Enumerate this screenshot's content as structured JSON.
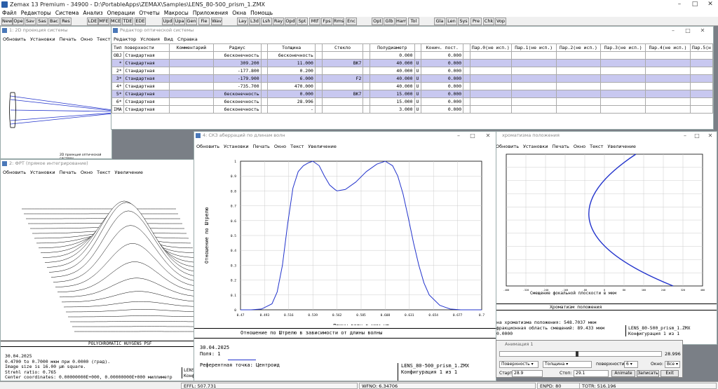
{
  "app": {
    "title": "Zemax 13 Premium - 34900 - D:\\PortableApps\\ZEMAX\\Samples\\LENS_80-500_prism_1.ZMX"
  },
  "menu": [
    "Файл",
    "Редакторы",
    "Система",
    "Анализ",
    "Операции",
    "Отчеты",
    "Макросы",
    "Приложения",
    "Окна",
    "Помощь"
  ],
  "toolbar": [
    "New",
    "Ope",
    "Sav",
    "Sas",
    "Bac",
    "Res",
    "LDE",
    "MFE",
    "MCE",
    "TDE",
    "EDE",
    "Upd",
    "Upa",
    "Gen",
    "Fie",
    "Wav",
    "Lay",
    "L3d",
    "Lsh",
    "Ray",
    "Opd",
    "Spt",
    "Mtf",
    "Fps",
    "Rms",
    "Enc",
    "Opt",
    "Glb",
    "Ham",
    "Tol",
    "Gla",
    "Len",
    "Sys",
    "Pre",
    "Chk",
    "Vop"
  ],
  "win_layout": {
    "title": "1: 2D проекция системы",
    "menu": [
      "Обновить",
      "Установки",
      "Печать",
      "Окно",
      "Текст",
      "Ув"
    ],
    "caption": "2D проекция оптической системы"
  },
  "win_editor": {
    "title": "Редактор оптической системы",
    "menu": [
      "Редактор",
      "Условия",
      "Вид",
      "Справка"
    ],
    "headers": [
      "Тип поверхности",
      "Комментарий",
      "Радиус",
      "",
      "Толщина",
      "",
      "Стекло",
      "",
      "Полудиаметр",
      "",
      "Конич. пост.",
      "",
      "Пар.0(не исп.)",
      "Пар.1(не исп.)",
      "Пар.2(не исп.)",
      "Пар.3(не исп.)",
      "Пар.4(не исп.)",
      "Пар.5(н"
    ],
    "rows": [
      {
        "n": "OBJ",
        "type": "Стандартная",
        "rad": "бесконечность",
        "th": "бесконечность",
        "glass": "",
        "sd": "0.000",
        "sdf": "",
        "con": "0.000",
        "hl": false
      },
      {
        "n": "*",
        "type": "Стандартная",
        "rad": "309.200",
        "th": "11.000",
        "glass": "BK7",
        "sd": "40.000",
        "sdf": "U",
        "con": "0.000",
        "hl": true
      },
      {
        "n": "2*",
        "type": "Стандартная",
        "rad": "-177.800",
        "th": "0.200",
        "glass": "",
        "sd": "40.000",
        "sdf": "U",
        "con": "0.000",
        "hl": false
      },
      {
        "n": "3*",
        "type": "Стандартная",
        "rad": "-179.900",
        "th": "6.000",
        "glass": "F2",
        "sd": "40.000",
        "sdf": "U",
        "con": "0.000",
        "hl": true
      },
      {
        "n": "4*",
        "type": "Стандартная",
        "rad": "-735.700",
        "th": "470.000",
        "glass": "",
        "sd": "40.000",
        "sdf": "U",
        "con": "0.000",
        "hl": false
      },
      {
        "n": "5*",
        "type": "Стандартная",
        "rad": "бесконечность",
        "th": "0.000",
        "glass": "BK7",
        "sd": "15.000",
        "sdf": "U",
        "con": "0.000",
        "hl": true
      },
      {
        "n": "6*",
        "type": "Стандартная",
        "rad": "бесконечность",
        "th": "28.996",
        "glass": "",
        "sd": "15.000",
        "sdf": "U",
        "con": "0.000",
        "hl": false
      },
      {
        "n": "IMA",
        "type": "Стандартная",
        "rad": "бесконечность",
        "th": "-",
        "glass": "",
        "sd": "3.000",
        "sdf": "U",
        "con": "0.000",
        "hl": false
      }
    ]
  },
  "win_psf": {
    "title": "2: ФРТ (прямое интегрирование)",
    "menu": [
      "Обновить",
      "Установки",
      "Печать",
      "Окно",
      "Текст",
      "Увеличение"
    ],
    "heading": "POLYCHROMATIC HUYGENS PSF",
    "date": "30.04.2025",
    "lines": [
      "0.4700 to 0.7000 мкм при 0.0000 (град).",
      "Image size is 16.00 µm square.",
      "Strehl ratio: 0.765",
      "Center coordinates: 0.00000000E+000, 0.00000000E+000 миллиметр"
    ],
    "corner": [
      "LENS",
      "Конфигурация 1 из 1"
    ]
  },
  "win_strehl": {
    "title": "4: СКЗ аберраций по длинам волн",
    "menu": [
      "Обновить",
      "Установки",
      "Печать",
      "Окно",
      "Текст",
      "Увеличение"
    ],
    "caption": "Отношение по Штрелю в зависимости от длины волны",
    "date": "30.04.2025",
    "field_label": "Поля:",
    "field_value": "1",
    "ref": "Референтная точка: Центроид",
    "lens": "LENS_80-500_prism_1.ZMX",
    "config": "Конфигурация 1 из 1"
  },
  "win_chrom": {
    "title": "хроматизма положения",
    "menu": [
      "Обновить",
      "Установки",
      "Печать",
      "Окно",
      "Текст",
      "Увеличение"
    ],
    "xlabel": "Смещение фокальной плоскости в мкм",
    "caption": "Хроматизм положения",
    "lines": [
      "на хроматизма положения: 548.7037 мкм",
      "фракционная область смещений: 89.433 мкм",
      "0.0000"
    ],
    "lens": "LENS_80-500_prism_1.ZMX",
    "config": "Конфигурация 1 из 1",
    "ticks": [
      "-400",
      "-320",
      "-240",
      "-160",
      "-80",
      "0",
      "80",
      "160",
      "240",
      "320",
      "400"
    ]
  },
  "anim": {
    "title": "Анимация 1",
    "value": "28.996",
    "type_sel": "Поверхность",
    "param_sel": "Толщина",
    "surf_label": "поверхности:",
    "surf_val": "6",
    "win_label": "Окно:",
    "win_val": "Все",
    "start_label": "Старт:",
    "start_val": "28.9",
    "stop_label": "Стоп:",
    "stop_val": "29.1",
    "b_animate": "Animate",
    "b_record": "Записать",
    "b_exit": "Exit"
  },
  "status": {
    "effl": "EFFL: 507.731",
    "wfno": "WFNO: 6.34706",
    "enpd": "ENPD: 80",
    "totr": "TOTR: 516.196"
  },
  "chart_data": {
    "type": "line",
    "title": "",
    "xlabel": "Длины волн в мкм µm",
    "ylabel": "Отношение по Штрелю",
    "xlim": [
      0.47,
      0.7
    ],
    "ylim": [
      0,
      1
    ],
    "xticks": [
      "0.47",
      "0.493",
      "0.516",
      "0.539",
      "0.562",
      "0.585",
      "0.608",
      "0.631",
      "0.654",
      "0.677",
      "0.7"
    ],
    "yticks": [
      "0",
      "0.1",
      "0.2",
      "0.3",
      "0.4",
      "0.5",
      "0.6",
      "0.7",
      "0.8",
      "0.9",
      "1"
    ],
    "x": [
      0.47,
      0.48,
      0.49,
      0.5,
      0.505,
      0.51,
      0.515,
      0.52,
      0.525,
      0.53,
      0.535,
      0.539,
      0.545,
      0.55,
      0.555,
      0.56,
      0.562,
      0.57,
      0.58,
      0.59,
      0.6,
      0.608,
      0.615,
      0.62,
      0.625,
      0.63,
      0.635,
      0.64,
      0.645,
      0.65,
      0.66,
      0.67,
      0.68,
      0.7
    ],
    "y": [
      0,
      0,
      0.005,
      0.04,
      0.12,
      0.3,
      0.58,
      0.82,
      0.93,
      0.97,
      0.99,
      1.0,
      0.97,
      0.9,
      0.84,
      0.81,
      0.8,
      0.81,
      0.86,
      0.93,
      0.98,
      1.0,
      0.97,
      0.9,
      0.78,
      0.62,
      0.45,
      0.3,
      0.18,
      0.1,
      0.03,
      0.005,
      0,
      0
    ],
    "grid": true
  }
}
